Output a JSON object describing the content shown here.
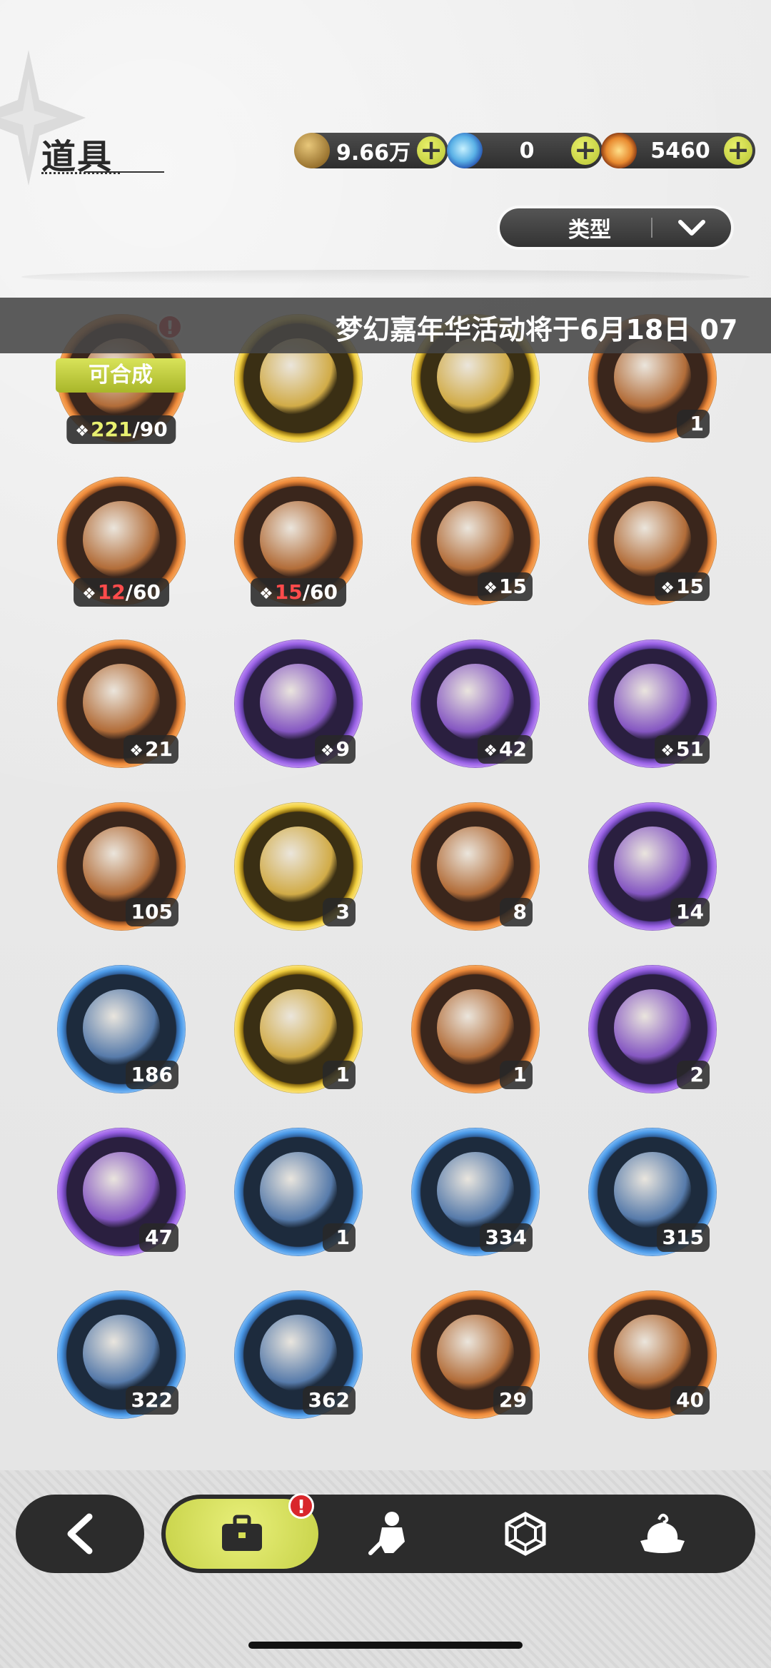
{
  "header": {
    "title": "道具"
  },
  "currencies": [
    {
      "id": "gold",
      "icon": "gold-coin-icon",
      "value": "9.66万"
    },
    {
      "id": "crystal",
      "icon": "crystal-icon",
      "value": "0"
    },
    {
      "id": "gem",
      "icon": "star-gem-icon",
      "value": "5460"
    }
  ],
  "filter": {
    "label": "类型"
  },
  "marquee": {
    "text": "梦幻嘉年华活动将于6月18日 07"
  },
  "items": [
    {
      "ring": "orange",
      "craft": "可合成",
      "frag_have": "221",
      "frag_need": "/90",
      "frag_state": "ok",
      "alert": true,
      "icon": "bear-plush-icon"
    },
    {
      "ring": "gold",
      "count": "",
      "icon": "treasure-chest-icon"
    },
    {
      "ring": "gold",
      "count": "",
      "icon": "treasure-chest-icon"
    },
    {
      "ring": "orange",
      "count": "1",
      "icon": "purple-crystal-shard-icon"
    },
    {
      "ring": "orange",
      "frag_have": "12",
      "frag_need": "/60",
      "frag_state": "warn",
      "icon": "brown-bear-plush-icon"
    },
    {
      "ring": "orange",
      "frag_have": "15",
      "frag_need": "/60",
      "frag_state": "warn",
      "icon": "knight-plush-icon"
    },
    {
      "ring": "orange",
      "frag_count": "15",
      "icon": "white-plush-icon"
    },
    {
      "ring": "orange",
      "frag_count": "15",
      "icon": "dark-bear-plush-icon"
    },
    {
      "ring": "orange",
      "frag_count": "21",
      "icon": "purple-mouse-plush-icon"
    },
    {
      "ring": "purple",
      "frag_count": "9",
      "icon": "frog-plush-icon"
    },
    {
      "ring": "purple",
      "frag_count": "42",
      "icon": "brown-pig-plush-icon"
    },
    {
      "ring": "purple",
      "frag_count": "51",
      "icon": "yellow-chick-plush-icon"
    },
    {
      "ring": "orange",
      "count": "105",
      "icon": "star-crystal-icon"
    },
    {
      "ring": "gold",
      "count": "3",
      "icon": "gold-character-card-icon"
    },
    {
      "ring": "orange",
      "count": "8",
      "icon": "orange-character-card-icon"
    },
    {
      "ring": "purple",
      "count": "14",
      "icon": "purple-character-card-icon"
    },
    {
      "ring": "blue",
      "count": "186",
      "icon": "blue-character-card-icon"
    },
    {
      "ring": "gold",
      "count": "1",
      "icon": "birthday-cake-icon"
    },
    {
      "ring": "orange",
      "count": "1",
      "icon": "rune-card-icon"
    },
    {
      "ring": "purple",
      "count": "2",
      "icon": "magic-mirror-icon"
    },
    {
      "ring": "purple",
      "count": "47",
      "icon": "peach-fruit-icon"
    },
    {
      "ring": "blue",
      "count": "1",
      "icon": "letter-envelope-icon"
    },
    {
      "ring": "blue",
      "count": "334",
      "icon": "shovel-icon"
    },
    {
      "ring": "blue",
      "count": "315",
      "icon": "gauntlet-icon"
    },
    {
      "ring": "blue",
      "count": "322",
      "icon": "pickaxe-icon"
    },
    {
      "ring": "blue",
      "count": "362",
      "icon": "hammer-icon"
    },
    {
      "ring": "orange",
      "count": "29",
      "icon": "ruby-heart-icon"
    },
    {
      "ring": "orange",
      "count": "40",
      "icon": "wheel-ticket-icon"
    }
  ],
  "bottom_nav": {
    "back_icon": "back-chevron-icon",
    "tabs": [
      {
        "icon": "bag-icon",
        "active": true,
        "alert": true
      },
      {
        "icon": "fighter-icon",
        "active": false
      },
      {
        "icon": "hexagon-gem-icon",
        "active": false
      },
      {
        "icon": "pudding-icon",
        "active": false
      }
    ]
  },
  "colors": {
    "accent_yellow": "#d6df55",
    "alert_red": "#d9262b",
    "ring_orange": "#ee8a3a",
    "ring_gold": "#f1cf3e",
    "ring_purple": "#9a62e6",
    "ring_blue": "#4b9ae8"
  }
}
